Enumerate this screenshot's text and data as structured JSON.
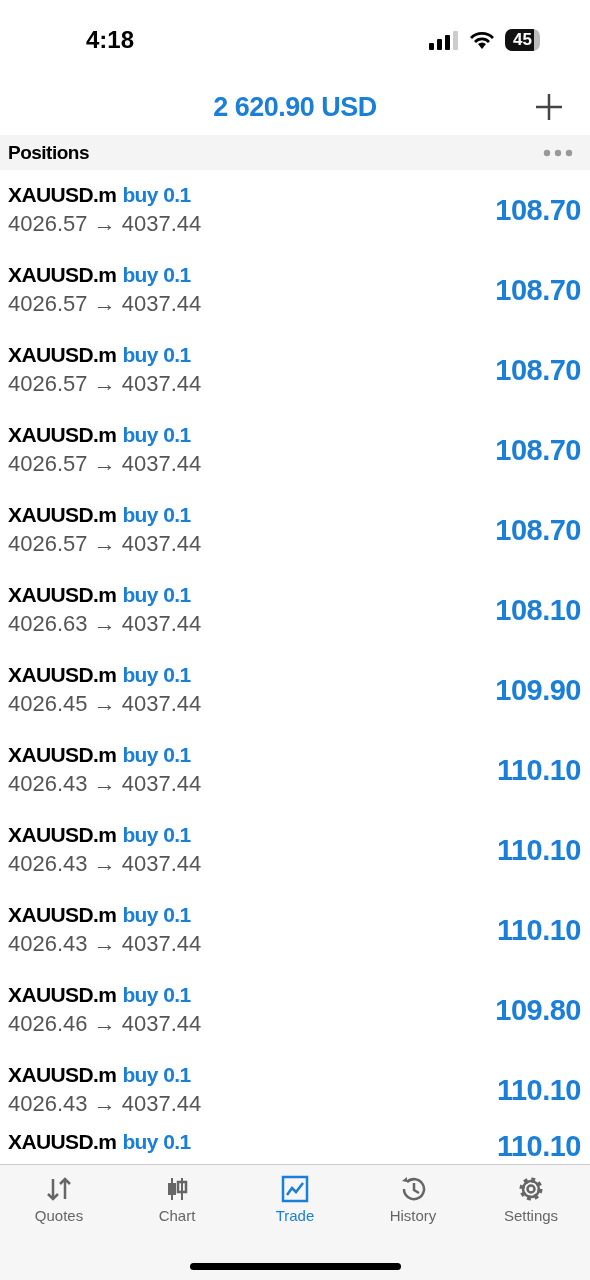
{
  "status_bar": {
    "time": "4:18",
    "battery": "45"
  },
  "header": {
    "balance": "2 620.90 USD"
  },
  "section": {
    "title": "Positions"
  },
  "positions": [
    {
      "symbol": "XAUUSD.m",
      "side": "buy 0.1",
      "prices": "4026.57 → 4037.44",
      "profit": "108.70"
    },
    {
      "symbol": "XAUUSD.m",
      "side": "buy 0.1",
      "prices": "4026.57 → 4037.44",
      "profit": "108.70"
    },
    {
      "symbol": "XAUUSD.m",
      "side": "buy 0.1",
      "prices": "4026.57 → 4037.44",
      "profit": "108.70"
    },
    {
      "symbol": "XAUUSD.m",
      "side": "buy 0.1",
      "prices": "4026.57 → 4037.44",
      "profit": "108.70"
    },
    {
      "symbol": "XAUUSD.m",
      "side": "buy 0.1",
      "prices": "4026.57 → 4037.44",
      "profit": "108.70"
    },
    {
      "symbol": "XAUUSD.m",
      "side": "buy 0.1",
      "prices": "4026.63 → 4037.44",
      "profit": "108.10"
    },
    {
      "symbol": "XAUUSD.m",
      "side": "buy 0.1",
      "prices": "4026.45 → 4037.44",
      "profit": "109.90"
    },
    {
      "symbol": "XAUUSD.m",
      "side": "buy 0.1",
      "prices": "4026.43 → 4037.44",
      "profit": "110.10"
    },
    {
      "symbol": "XAUUSD.m",
      "side": "buy 0.1",
      "prices": "4026.43 → 4037.44",
      "profit": "110.10"
    },
    {
      "symbol": "XAUUSD.m",
      "side": "buy 0.1",
      "prices": "4026.43 → 4037.44",
      "profit": "110.10"
    },
    {
      "symbol": "XAUUSD.m",
      "side": "buy 0.1",
      "prices": "4026.46 → 4037.44",
      "profit": "109.80"
    },
    {
      "symbol": "XAUUSD.m",
      "side": "buy 0.1",
      "prices": "4026.43 → 4037.44",
      "profit": "110.10"
    },
    {
      "symbol": "XAUUSD.m",
      "side": "buy 0.1",
      "profit": "110.10"
    }
  ],
  "tabs": [
    {
      "kind": "quotes",
      "label": "Quotes",
      "selected": false
    },
    {
      "kind": "chart",
      "label": "Chart",
      "selected": false
    },
    {
      "kind": "trade",
      "label": "Trade",
      "selected": true
    },
    {
      "kind": "history",
      "label": "History",
      "selected": false
    },
    {
      "kind": "settings",
      "label": "Settings",
      "selected": false
    }
  ]
}
